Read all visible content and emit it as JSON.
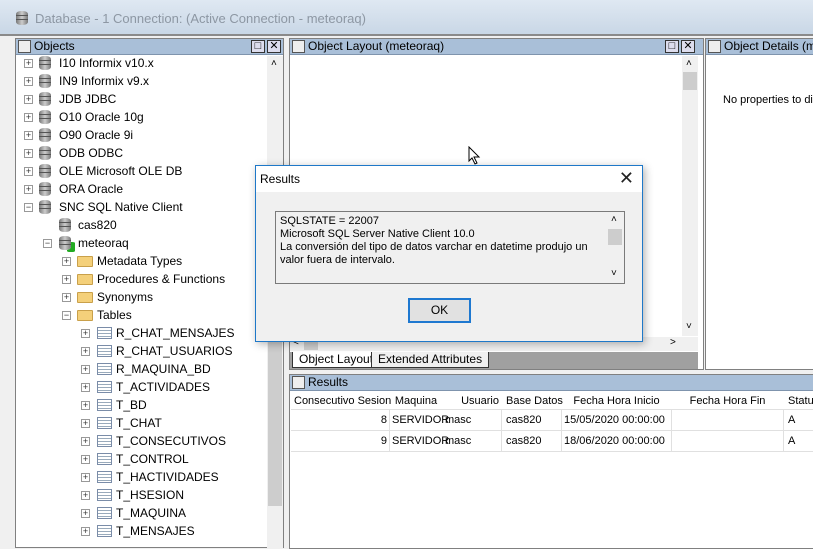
{
  "window": {
    "title": "Database - 1 Connection: (Active Connection - meteoraq)"
  },
  "objects_panel": {
    "title": "Objects",
    "tree": [
      {
        "label": "I10 Informix v10.x",
        "level": 0,
        "icon": "database-icon",
        "expander": "+"
      },
      {
        "label": "IN9 Informix v9.x",
        "level": 0,
        "icon": "database-icon",
        "expander": "+"
      },
      {
        "label": "JDB JDBC",
        "level": 0,
        "icon": "database-icon",
        "expander": "+"
      },
      {
        "label": "O10 Oracle 10g",
        "level": 0,
        "icon": "database-icon",
        "expander": "+"
      },
      {
        "label": "O90 Oracle 9i",
        "level": 0,
        "icon": "database-icon",
        "expander": "+"
      },
      {
        "label": "ODB ODBC",
        "level": 0,
        "icon": "database-icon",
        "expander": "+"
      },
      {
        "label": "OLE Microsoft OLE DB",
        "level": 0,
        "icon": "database-icon",
        "expander": "+"
      },
      {
        "label": "ORA Oracle",
        "level": 0,
        "icon": "database-icon",
        "expander": "+"
      },
      {
        "label": "SNC SQL Native Client",
        "level": 0,
        "icon": "database-icon",
        "expander": "-"
      },
      {
        "label": "cas820",
        "level": 1,
        "icon": "database-icon",
        "expander": ""
      },
      {
        "label": "meteoraq",
        "level": 1,
        "icon": "connected-database-icon",
        "expander": "-"
      },
      {
        "label": "Metadata Types",
        "level": 2,
        "icon": "folder-icon",
        "expander": "+"
      },
      {
        "label": "Procedures & Functions",
        "level": 2,
        "icon": "folder-icon",
        "expander": "+"
      },
      {
        "label": "Synonyms",
        "level": 2,
        "icon": "folder-icon",
        "expander": "+"
      },
      {
        "label": "Tables",
        "level": 2,
        "icon": "folder-icon",
        "expander": "-"
      },
      {
        "label": "R_CHAT_MENSAJES",
        "level": 3,
        "icon": "table-icon",
        "expander": "+"
      },
      {
        "label": "R_CHAT_USUARIOS",
        "level": 3,
        "icon": "table-icon",
        "expander": "+"
      },
      {
        "label": "R_MAQUINA_BD",
        "level": 3,
        "icon": "table-icon",
        "expander": "+"
      },
      {
        "label": "T_ACTIVIDADES",
        "level": 3,
        "icon": "table-icon",
        "expander": "+"
      },
      {
        "label": "T_BD",
        "level": 3,
        "icon": "table-icon",
        "expander": "+"
      },
      {
        "label": "T_CHAT",
        "level": 3,
        "icon": "table-icon",
        "expander": "+"
      },
      {
        "label": "T_CONSECUTIVOS",
        "level": 3,
        "icon": "table-icon",
        "expander": "+"
      },
      {
        "label": "T_CONTROL",
        "level": 3,
        "icon": "table-icon",
        "expander": "+"
      },
      {
        "label": "T_HACTIVIDADES",
        "level": 3,
        "icon": "table-icon",
        "expander": "+"
      },
      {
        "label": "T_HSESION",
        "level": 3,
        "icon": "table-icon",
        "expander": "+"
      },
      {
        "label": "T_MAQUINA",
        "level": 3,
        "icon": "table-icon",
        "expander": "+"
      },
      {
        "label": "T_MENSAJES",
        "level": 3,
        "icon": "table-icon",
        "expander": "+"
      }
    ]
  },
  "layout_panel": {
    "title": "Object Layout (meteoraq)",
    "tabs": [
      "Object Layout",
      "Extended Attributes"
    ]
  },
  "details_panel": {
    "title": "Object Details (me",
    "message": "No properties to di"
  },
  "results_panel": {
    "title": "Results",
    "columns": [
      "Consecutivo Sesion",
      "Maquina",
      "Usuario",
      "Base Datos",
      "Fecha Hora Inicio",
      "Fecha Hora Fin",
      "Status"
    ],
    "rows": [
      [
        "8",
        "SERVIDOR",
        "masc",
        "cas820",
        "15/05/2020 00:00:00",
        "",
        "A"
      ],
      [
        "9",
        "SERVIDOR",
        "masc",
        "cas820",
        "18/06/2020 00:00:00",
        "",
        "A"
      ]
    ]
  },
  "dialog": {
    "title": "Results",
    "lines": [
      "SQLSTATE = 22007",
      "Microsoft SQL Server Native Client 10.0",
      "La conversión del tipo de datos varchar en datetime produjo un valor fuera de intervalo."
    ],
    "ok_label": "OK"
  },
  "colors": {
    "panel_header": "#a9bfd8",
    "dialog_border": "#1e78c8"
  }
}
